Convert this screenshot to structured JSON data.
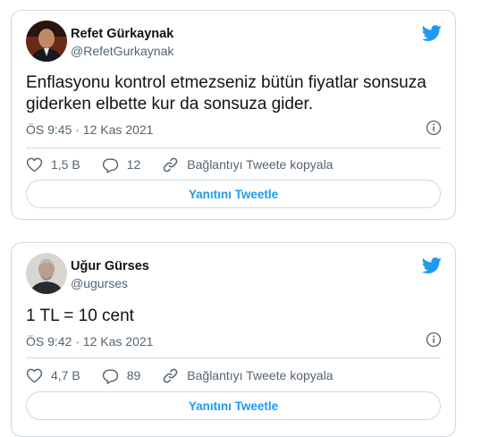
{
  "colors": {
    "accent": "#1d9bf0",
    "muted": "#536471",
    "text": "#0f1419",
    "border": "#cfd9de"
  },
  "tweets": [
    {
      "author_name": "Refet Gürkaynak",
      "handle": "@RefetGurkaynak",
      "text": "Enflasyonu kontrol etmezseniz bütün fiyatlar sonsuza giderken elbette kur da sonsuza gider.",
      "timestamp": "ÖS 9:45 · 12 Kas 2021",
      "likes": "1,5 B",
      "replies": "12",
      "copy_link_label": "Bağlantıyı Tweete kopyala",
      "reply_button_label": "Yanıtını Tweetle"
    },
    {
      "author_name": "Uğur Gürses",
      "handle": "@ugurses",
      "text": "1 TL = 10 cent",
      "timestamp": "ÖS 9:42 · 12 Kas 2021",
      "likes": "4,7 B",
      "replies": "89",
      "copy_link_label": "Bağlantıyı Tweete kopyala",
      "reply_button_label": "Yanıtını Tweetle"
    }
  ]
}
